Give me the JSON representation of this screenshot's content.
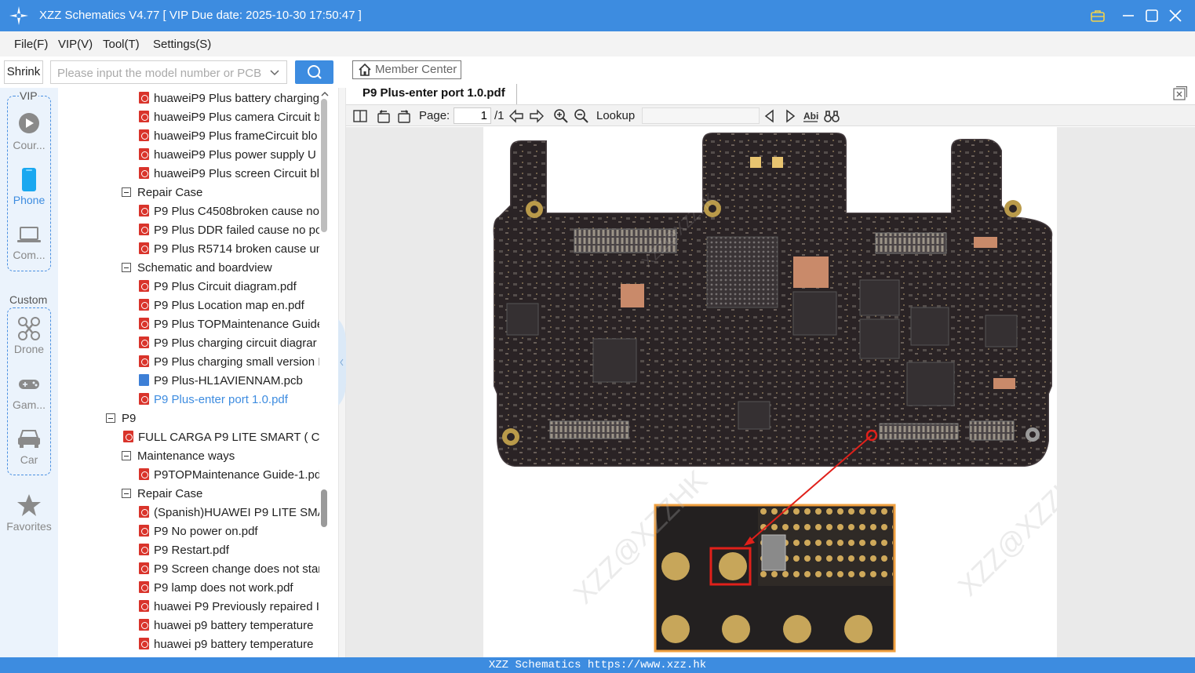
{
  "app": {
    "title": "XZZ Schematics V4.77 [ VIP Due date: 2025-10-30 17:50:47 ]"
  },
  "menu": [
    "File(F)",
    "VIP(V)",
    "Tool(T)",
    "Settings(S)"
  ],
  "search": {
    "shrink_label": "Shrink",
    "placeholder": "Please input the model number or PCB"
  },
  "rail": {
    "vip_label": "VIP",
    "custom_label": "Custom",
    "items": [
      {
        "label": "Cour...",
        "icon": "play-icon"
      },
      {
        "label": "Phone",
        "icon": "phone-icon"
      },
      {
        "label": "Com...",
        "icon": "laptop-icon"
      },
      {
        "label": "Drone",
        "icon": "drone-icon"
      },
      {
        "label": "Gam...",
        "icon": "gamepad-icon"
      },
      {
        "label": "Car",
        "icon": "car-icon"
      },
      {
        "label": "Favorites",
        "icon": "star-icon"
      }
    ]
  },
  "tree": [
    {
      "type": "pdf",
      "label": "huaweiP9 Plus battery charging"
    },
    {
      "type": "pdf",
      "label": "huaweiP9 Plus camera Circuit b"
    },
    {
      "type": "pdf",
      "label": "huaweiP9 Plus frameCircuit blo"
    },
    {
      "type": "pdf",
      "label": "huaweiP9 Plus power supply U"
    },
    {
      "type": "pdf",
      "label": "huaweiP9 Plus screen Circuit bl"
    },
    {
      "type": "folder",
      "label": "Repair Case"
    },
    {
      "type": "pdf",
      "label": "P9 Plus C4508broken cause no"
    },
    {
      "type": "pdf",
      "label": "P9 Plus DDR failed cause no po"
    },
    {
      "type": "pdf",
      "label": "P9 Plus R5714 broken cause un"
    },
    {
      "type": "folder",
      "label": "Schematic and boardview"
    },
    {
      "type": "pdf",
      "label": "P9 Plus Circuit diagram.pdf"
    },
    {
      "type": "pdf",
      "label": "P9 Plus Location map en.pdf"
    },
    {
      "type": "pdf",
      "label": "P9 Plus TOPMaintenance Guide"
    },
    {
      "type": "pdf",
      "label": "P9 Plus charging circuit diagrar"
    },
    {
      "type": "pdf",
      "label": "P9 Plus charging small version I"
    },
    {
      "type": "pcb",
      "label": "P9 Plus-HL1AVIENNAM.pcb"
    },
    {
      "type": "pdf",
      "label": "P9 Plus-enter port 1.0.pdf",
      "selected": true
    },
    {
      "type": "folder0",
      "label": "P9"
    },
    {
      "type": "pdf1",
      "label": "FULL CARGA P9 LITE SMART ( CHA"
    },
    {
      "type": "folder",
      "label": "Maintenance ways"
    },
    {
      "type": "pdf",
      "label": "P9TOPMaintenance Guide-1.pd"
    },
    {
      "type": "folder",
      "label": "Repair Case"
    },
    {
      "type": "pdf",
      "label": "(Spanish)HUAWEI P9 LITE SMAI"
    },
    {
      "type": "pdf",
      "label": "P9 No power on.pdf"
    },
    {
      "type": "pdf",
      "label": "P9 Restart.pdf"
    },
    {
      "type": "pdf",
      "label": "P9 Screen change does not star"
    },
    {
      "type": "pdf",
      "label": "P9 lamp does not work.pdf"
    },
    {
      "type": "pdf",
      "label": "huawei P9 Previously repaired I"
    },
    {
      "type": "pdf",
      "label": "huawei p9 battery temperature"
    },
    {
      "type": "pdf",
      "label": "huawei p9 battery temperature"
    }
  ],
  "viewer": {
    "member_center": "Member Center",
    "tab_label": "P9 Plus-enter port 1.0.pdf",
    "page_label": "Page:",
    "page_value": "1",
    "page_total": "/1",
    "lookup_label": "Lookup",
    "watermark": "XZZ@XZZHK"
  },
  "status": "XZZ Schematics https://www.xzz.hk",
  "colors": {
    "accent": "#3d8ce0",
    "pdf_red": "#d9342b",
    "board": "#2a2325",
    "highlight_red": "#e0201a",
    "zoom_frame": "#f0a040"
  }
}
